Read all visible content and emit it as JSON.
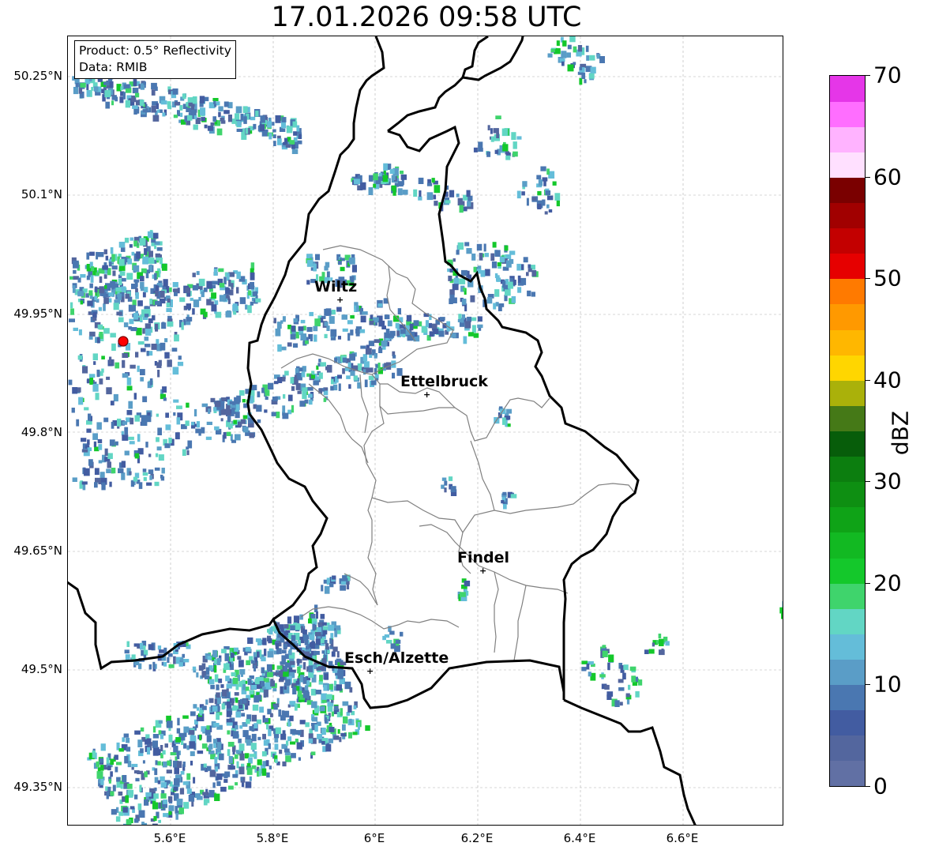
{
  "title": "17.01.2026 09:58 UTC",
  "info": {
    "product": "Product: 0.5° Reflectivity",
    "source": "Data: RMIB"
  },
  "lat_ticks": [
    "50.25°N",
    "50.1°N",
    "49.95°N",
    "49.8°N",
    "49.65°N",
    "49.5°N",
    "49.35°N"
  ],
  "lon_ticks": [
    "5.6°E",
    "5.8°E",
    "6°E",
    "6.2°E",
    "6.4°E",
    "6.6°E"
  ],
  "colorbar": {
    "unit": "dBZ",
    "tick_labels": [
      "0",
      "10",
      "20",
      "30",
      "40",
      "50",
      "60",
      "70"
    ],
    "colors": [
      "#6170a4",
      "#53669e",
      "#425ca1",
      "#4a77b1",
      "#5a9dc7",
      "#64bdd9",
      "#62d6c4",
      "#3fd46c",
      "#14c82b",
      "#12b922",
      "#0fa317",
      "#0e8f12",
      "#0c7e0f",
      "#075d0a",
      "#457917",
      "#aab10a",
      "#ffd600",
      "#ffb700",
      "#ff9900",
      "#ff7a00",
      "#e60000",
      "#c30000",
      "#a10000",
      "#7a0000",
      "#ffe0ff",
      "#ffb3ff",
      "#ff6eff",
      "#e536e8"
    ]
  },
  "radar_site": {
    "name": "radar-site",
    "color": "#ff0000"
  },
  "cities": [
    {
      "name": "Wiltz"
    },
    {
      "name": "Ettelbruck"
    },
    {
      "name": "Findel"
    },
    {
      "name": "Esch/Alzette"
    }
  ],
  "colors": {
    "border": "#000000",
    "canton": "#808080",
    "grid": "#b0b0b0"
  }
}
